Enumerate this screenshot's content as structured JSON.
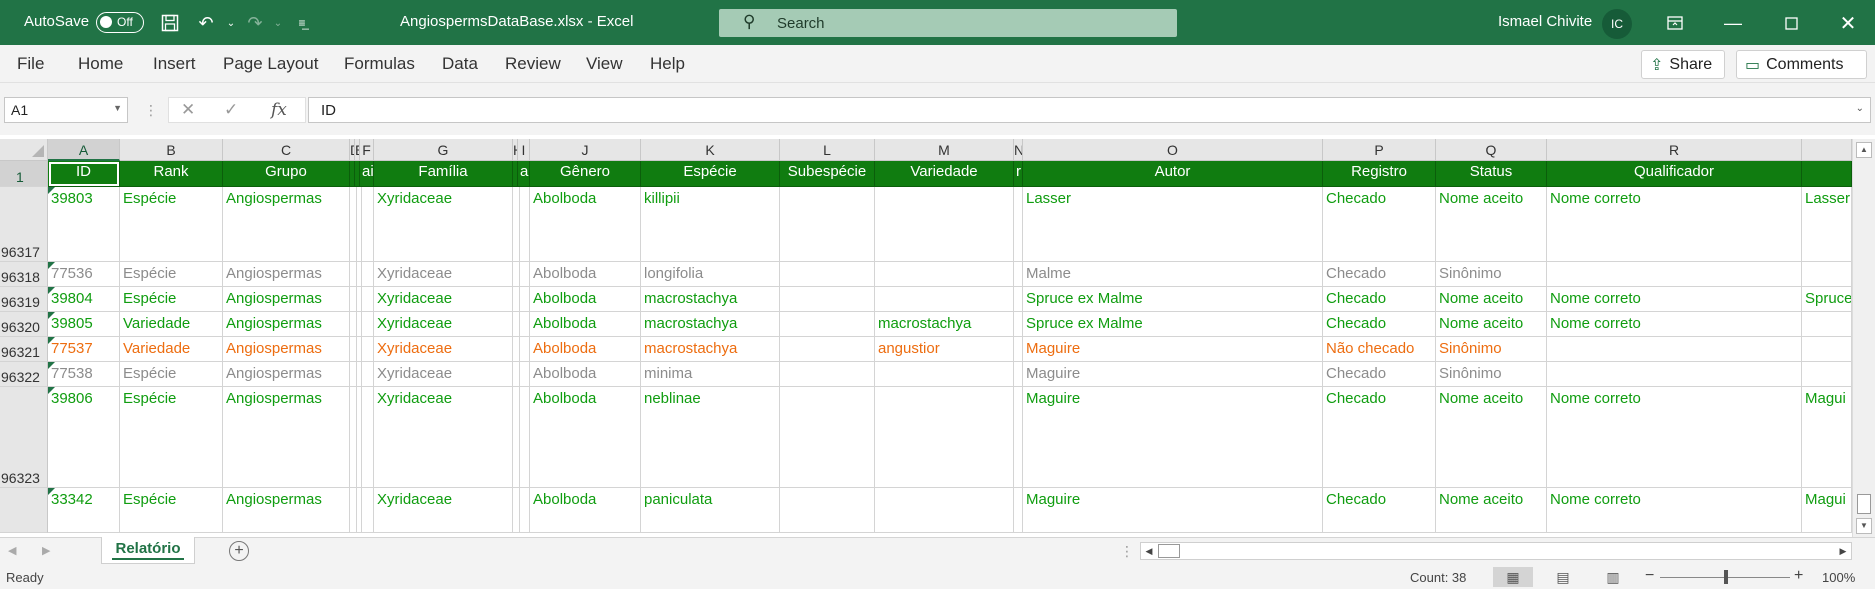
{
  "titlebar": {
    "autosave_label": "AutoSave",
    "autosave_state": "Off",
    "document_title": "AngiospermsDataBase.xlsx  -  Excel",
    "search_placeholder": "Search",
    "user_name": "Ismael Chivite",
    "user_initials": "IC"
  },
  "ribbon": {
    "tabs": [
      "File",
      "Home",
      "Insert",
      "Page Layout",
      "Formulas",
      "Data",
      "Review",
      "View",
      "Help"
    ],
    "share_label": "Share",
    "comments_label": "Comments"
  },
  "formula_bar": {
    "name_box": "A1",
    "formula": "ID",
    "fx_label": "fx"
  },
  "grid": {
    "column_letters": [
      "A",
      "B",
      "C",
      "D",
      "E",
      "F",
      "G",
      "H",
      "I",
      "J",
      "K",
      "L",
      "M",
      "N",
      "O",
      "P",
      "Q",
      "R",
      ""
    ],
    "header_row_number": "1",
    "header_values": [
      "ID",
      "Rank",
      "Grupo",
      "",
      "",
      "aid",
      "Família",
      "",
      "ail",
      "Gênero",
      "Espécie",
      "Subespécie",
      "Variedade",
      "r",
      "Autor",
      "Registro",
      "Status",
      "Qualificador",
      ""
    ],
    "rows": [
      {
        "num": "96317",
        "style": "green",
        "cells": [
          "39803",
          "Espécie",
          "Angiospermas",
          "",
          "",
          "",
          "Xyridaceae",
          "",
          "",
          "Abolboda",
          "killipii",
          "",
          "",
          "",
          "Lasser",
          "Checado",
          "Nome aceito",
          "Nome correto",
          "Lasser"
        ]
      },
      {
        "num": "96318",
        "style": "gray",
        "cells": [
          "77536",
          "Espécie",
          "Angiospermas",
          "",
          "",
          "",
          "Xyridaceae",
          "",
          "",
          "Abolboda",
          "longifolia",
          "",
          "",
          "",
          "Malme",
          "Checado",
          "Sinônimo",
          "",
          ""
        ]
      },
      {
        "num": "96319",
        "style": "green",
        "cells": [
          "39804",
          "Espécie",
          "Angiospermas",
          "",
          "",
          "",
          "Xyridaceae",
          "",
          "",
          "Abolboda",
          "macrostachya",
          "",
          "",
          "",
          "Spruce ex Malme",
          "Checado",
          "Nome aceito",
          "Nome correto",
          "Spruce"
        ]
      },
      {
        "num": "96320",
        "style": "green",
        "cells": [
          "39805",
          "Variedade",
          "Angiospermas",
          "",
          "",
          "",
          "Xyridaceae",
          "",
          "",
          "Abolboda",
          "macrostachya",
          "",
          "macrostachya",
          "",
          "Spruce ex Malme",
          "Checado",
          "Nome aceito",
          "Nome correto",
          ""
        ]
      },
      {
        "num": "96321",
        "style": "orange",
        "cells": [
          "77537",
          "Variedade",
          "Angiospermas",
          "",
          "",
          "",
          "Xyridaceae",
          "",
          "",
          "Abolboda",
          "macrostachya",
          "",
          "angustior",
          "",
          "Maguire",
          "Não checado",
          "Sinônimo",
          "",
          ""
        ]
      },
      {
        "num": "96322",
        "style": "gray",
        "cells": [
          "77538",
          "Espécie",
          "Angiospermas",
          "",
          "",
          "",
          "Xyridaceae",
          "",
          "",
          "Abolboda",
          "minima",
          "",
          "",
          "",
          "Maguire",
          "Checado",
          "Sinônimo",
          "",
          ""
        ]
      },
      {
        "num": "96323",
        "style": "green",
        "cells": [
          "39806",
          "Espécie",
          "Angiospermas",
          "",
          "",
          "",
          "Xyridaceae",
          "",
          "",
          "Abolboda",
          "neblinae",
          "",
          "",
          "",
          "Maguire",
          "Checado",
          "Nome aceito",
          "Nome correto",
          "Magui"
        ]
      },
      {
        "num": "",
        "style": "green",
        "cells": [
          "33342",
          "Espécie",
          "Angiospermas",
          "",
          "",
          "",
          "Xyridaceae",
          "",
          "",
          "Abolboda",
          "paniculata",
          "",
          "",
          "",
          "Maguire",
          "Checado",
          "Nome aceito",
          "Nome correto",
          "Magui"
        ]
      }
    ]
  },
  "sheets": {
    "active": "Relatório"
  },
  "statusbar": {
    "ready": "Ready",
    "count": "Count: 38",
    "zoom": "100%"
  },
  "colors": {
    "excel_green": "#217346",
    "header_fill": "#107c10",
    "accepted_text": "#109d10",
    "synonym_text": "#8c8c8c",
    "unchecked_text": "#ed6d10"
  }
}
